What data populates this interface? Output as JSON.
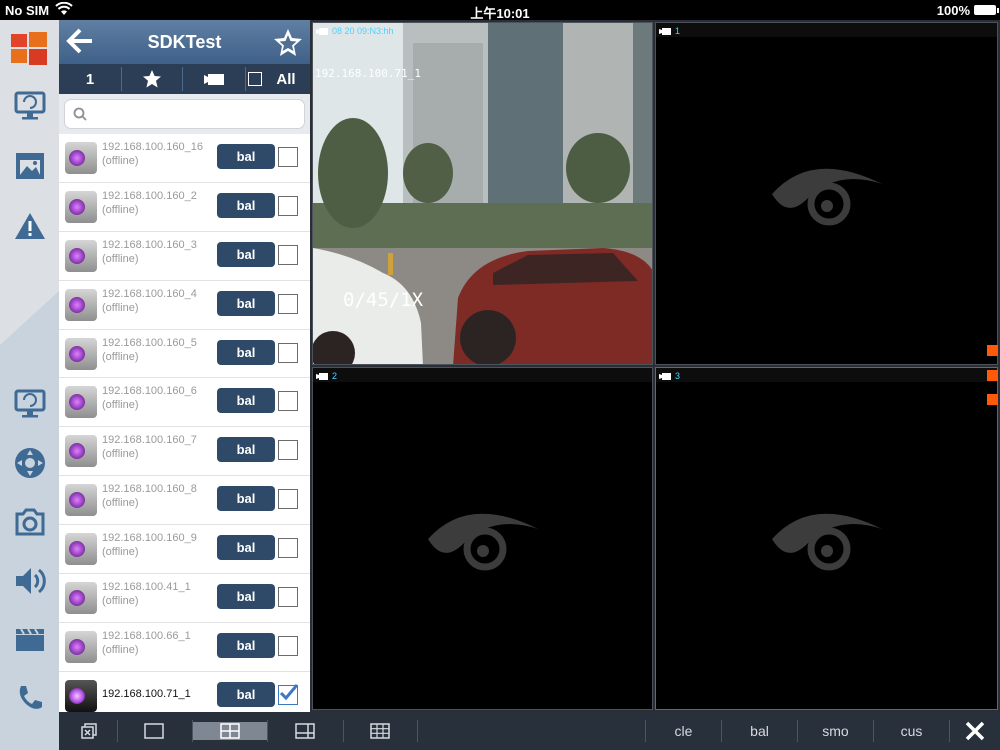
{
  "status": {
    "carrier": "No SIM",
    "time": "上午10:01",
    "battery": "100%"
  },
  "panel": {
    "title": "SDKTest",
    "tabs": {
      "group": "1",
      "all": "All"
    },
    "search": {
      "placeholder": ""
    },
    "devices": [
      {
        "name": "192.168.100.160_16",
        "status": "(offline)",
        "button": "bal",
        "checked": false
      },
      {
        "name": "192.168.100.160_2",
        "status": "(offline)",
        "button": "bal",
        "checked": false
      },
      {
        "name": "192.168.100.160_3",
        "status": "(offline)",
        "button": "bal",
        "checked": false
      },
      {
        "name": "192.168.100.160_4",
        "status": "(offline)",
        "button": "bal",
        "checked": false
      },
      {
        "name": "192.168.100.160_5",
        "status": "(offline)",
        "button": "bal",
        "checked": false
      },
      {
        "name": "192.168.100.160_6",
        "status": "(offline)",
        "button": "bal",
        "checked": false
      },
      {
        "name": "192.168.100.160_7",
        "status": "(offline)",
        "button": "bal",
        "checked": false
      },
      {
        "name": "192.168.100.160_8",
        "status": "(offline)",
        "button": "bal",
        "checked": false
      },
      {
        "name": "192.168.100.160_9",
        "status": "(offline)",
        "button": "bal",
        "checked": false
      },
      {
        "name": "192.168.100.41_1",
        "status": "(offline)",
        "button": "bal",
        "checked": false
      },
      {
        "name": "192.168.100.66_1",
        "status": "(offline)",
        "button": "bal",
        "checked": false
      },
      {
        "name": "192.168.100.71_1",
        "status": "",
        "button": "bal",
        "checked": true
      }
    ]
  },
  "video": {
    "cells": [
      {
        "label": "",
        "osd_time": "08 20 09:N3:hh",
        "osd_ip": "192.168.100.71_1",
        "osd_speed": "0/45/1X"
      },
      {
        "label": "1"
      },
      {
        "label": "2"
      },
      {
        "label": "3"
      }
    ]
  },
  "toolbar": {
    "quality": [
      "cle",
      "bal",
      "smo",
      "cus"
    ]
  },
  "colors": {
    "accent": "#2f4a69",
    "alert": "#ff5a0a",
    "selected_border": "#4568b6"
  },
  "icons": [
    "windows-logo-icon",
    "monitor-icon",
    "media-icon",
    "warning-icon",
    "monitor-playback-icon",
    "ptz-icon",
    "camera-icon",
    "speaker-icon",
    "clapper-icon",
    "phone-icon"
  ]
}
